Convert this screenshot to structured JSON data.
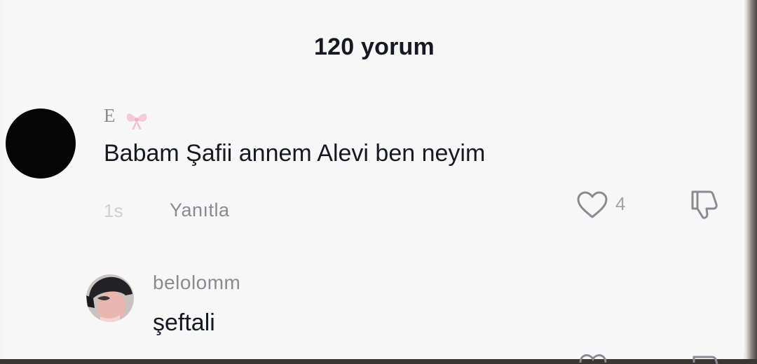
{
  "header": {
    "title": "120 yorum"
  },
  "comments": [
    {
      "author": "E",
      "author_decoration_icon": "pink-bow-icon",
      "text": "Babam Şafii annem Alevi ben neyim",
      "time": "1s",
      "reply_label": "Yanıtla",
      "like_count": "4"
    },
    {
      "author": "belolomm",
      "text": "şeftali"
    }
  ],
  "colors": {
    "background": "#f7f7f7",
    "primary_text": "#161823",
    "secondary_text": "#8a8b91"
  }
}
